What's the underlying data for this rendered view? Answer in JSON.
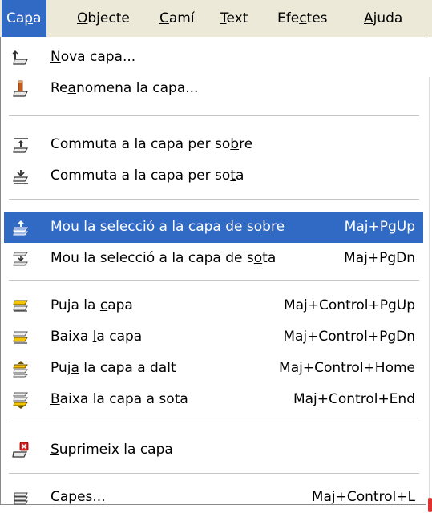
{
  "menubar": {
    "items": [
      {
        "pre": "Ca",
        "u": "p",
        "post": "a"
      },
      {
        "pre": "",
        "u": "O",
        "post": "bjecte"
      },
      {
        "pre": "",
        "u": "C",
        "post": "amí"
      },
      {
        "pre": "",
        "u": "T",
        "post": "ext"
      },
      {
        "pre": "Efe",
        "u": "c",
        "post": "tes"
      },
      {
        "pre": "",
        "u": "A",
        "post": "juda"
      }
    ]
  },
  "menu": {
    "items": [
      {
        "pre": "",
        "u": "N",
        "post": "ova capa...",
        "shortcut": "",
        "icon": "new-layer-icon"
      },
      {
        "pre": "Re",
        "u": "a",
        "post": "nomena la capa...",
        "shortcut": "",
        "icon": "rename-layer-icon"
      },
      {
        "pre": "Commuta a la capa per so",
        "u": "b",
        "post": "re",
        "shortcut": "",
        "icon": "switch-layer-above-icon"
      },
      {
        "pre": "Commuta a la capa per so",
        "u": "t",
        "post": "a",
        "shortcut": "",
        "icon": "switch-layer-below-icon"
      },
      {
        "pre": "Mou la selecció a la capa de so",
        "u": "b",
        "post": "re",
        "shortcut": "Maj+PgUp",
        "icon": "move-selection-up-icon"
      },
      {
        "pre": "Mou la selecció a la capa de s",
        "u": "o",
        "post": "ta",
        "shortcut": "Maj+PgDn",
        "icon": "move-selection-down-icon"
      },
      {
        "pre": "Puja la ",
        "u": "c",
        "post": "apa",
        "shortcut": "Maj+Control+PgUp",
        "icon": "raise-layer-icon"
      },
      {
        "pre": "Baixa ",
        "u": "l",
        "post": "a capa",
        "shortcut": "Maj+Control+PgDn",
        "icon": "lower-layer-icon"
      },
      {
        "pre": "Puj",
        "u": "a",
        "post": " la capa a dalt",
        "shortcut": "Maj+Control+Home",
        "icon": "layer-to-top-icon"
      },
      {
        "pre": "",
        "u": "B",
        "post": "aixa la capa a sota",
        "shortcut": "Maj+Control+End",
        "icon": "layer-to-bottom-icon"
      },
      {
        "pre": "",
        "u": "S",
        "post": "uprimeix la capa",
        "shortcut": "",
        "icon": "delete-layer-icon"
      },
      {
        "pre": "Capes...",
        "u": "",
        "post": "",
        "shortcut": "Maj+Control+L",
        "icon": "layers-dialog-icon"
      }
    ]
  },
  "colors": {
    "highlight": "#316ac5",
    "menubar_bg": "#ece9d8",
    "separator": "#c5c5c5"
  }
}
